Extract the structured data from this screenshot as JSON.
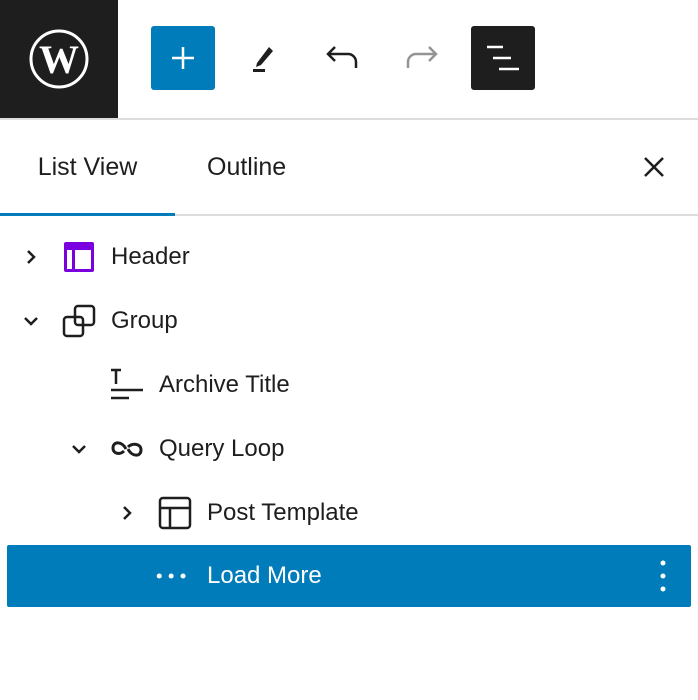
{
  "colors": {
    "accent": "#007cba",
    "header_icon": "#7a00df"
  },
  "toolbar": {
    "logo": "wordpress-logo",
    "buttons": [
      {
        "name": "add-block",
        "icon": "plus-icon"
      },
      {
        "name": "tools",
        "icon": "pen-icon"
      },
      {
        "name": "undo",
        "icon": "undo-icon"
      },
      {
        "name": "redo",
        "icon": "redo-icon"
      },
      {
        "name": "document-overview",
        "icon": "list-view-icon"
      }
    ]
  },
  "tabs": [
    {
      "label": "List View",
      "active": true
    },
    {
      "label": "Outline",
      "active": false
    }
  ],
  "tree": [
    {
      "label": "Header",
      "level": 0,
      "expander": "collapsed",
      "icon": "template-part-icon"
    },
    {
      "label": "Group",
      "level": 0,
      "expander": "expanded",
      "icon": "group-icon"
    },
    {
      "label": "Archive Title",
      "level": 1,
      "expander": "none",
      "icon": "title-icon"
    },
    {
      "label": "Query Loop",
      "level": 1,
      "expander": "expanded",
      "icon": "loop-icon"
    },
    {
      "label": "Post Template",
      "level": 2,
      "expander": "collapsed",
      "icon": "layout-icon"
    },
    {
      "label": "Load More",
      "level": 2,
      "expander": "none",
      "icon": "more-dots-icon",
      "selected": true
    }
  ]
}
